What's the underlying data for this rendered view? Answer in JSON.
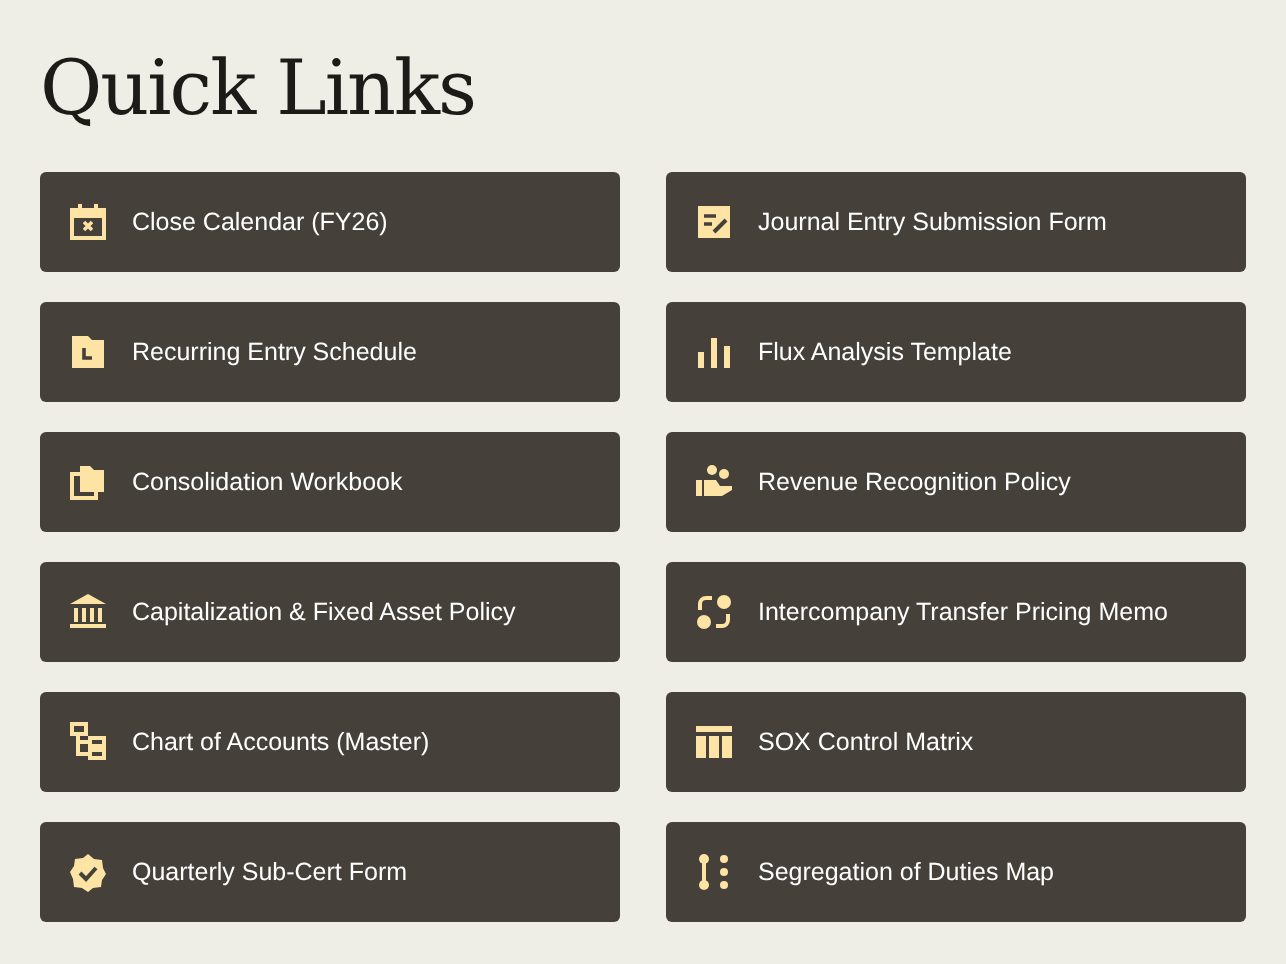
{
  "title": "Quick Links",
  "links": [
    {
      "label": "Close Calendar (FY26)"
    },
    {
      "label": "Journal Entry Submission Form"
    },
    {
      "label": "Recurring Entry Schedule"
    },
    {
      "label": "Flux Analysis Template"
    },
    {
      "label": "Consolidation Workbook"
    },
    {
      "label": "Revenue Recognition Policy"
    },
    {
      "label": "Capitalization & Fixed Asset Policy"
    },
    {
      "label": "Intercompany Transfer Pricing Memo"
    },
    {
      "label": "Chart of Accounts (Master)"
    },
    {
      "label": "SOX Control Matrix"
    },
    {
      "label": "Quarterly Sub-Cert Form"
    },
    {
      "label": "Segregation of Duties Map"
    }
  ]
}
